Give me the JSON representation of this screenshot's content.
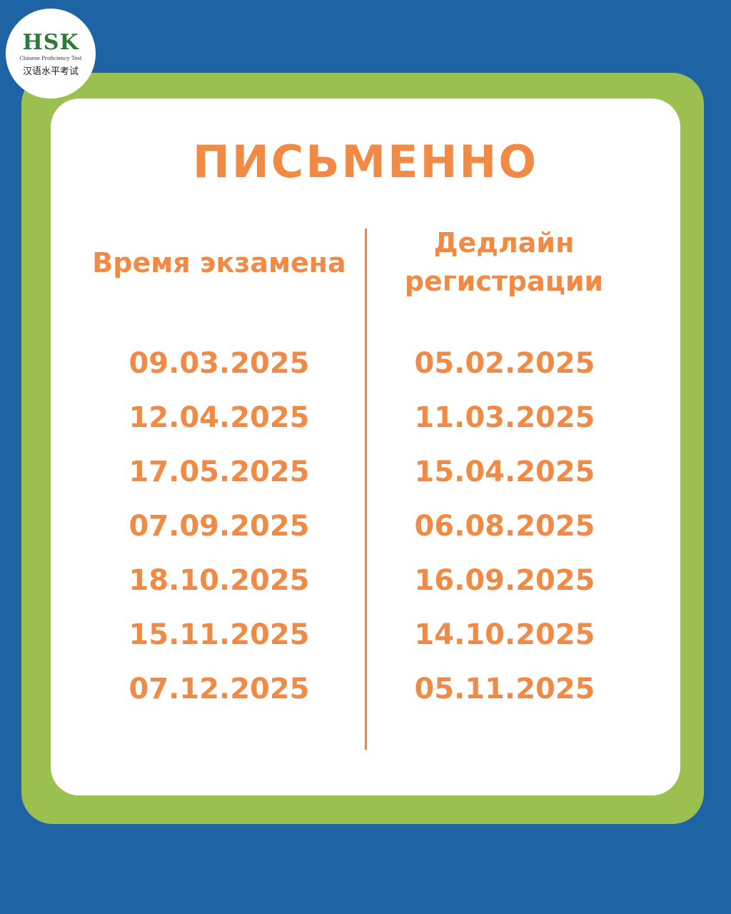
{
  "logo": {
    "main": "HSK",
    "sub": "Chinese Proficiency Test",
    "cn": "汉语水平考试"
  },
  "title": "ПИСЬМЕННО",
  "columns": {
    "exam": {
      "header": "Время экзамена",
      "dates": [
        "09.03.2025",
        "12.04.2025",
        "17.05.2025",
        "07.09.2025",
        "18.10.2025",
        "15.11.2025",
        "07.12.2025"
      ]
    },
    "deadline": {
      "header_line1": "Дедлайн",
      "header_line2": "регистрации",
      "dates": [
        "05.02.2025",
        "11.03.2025",
        "15.04.2025",
        "06.08.2025",
        "16.09.2025",
        "14.10.2025",
        "05.11.2025"
      ]
    }
  },
  "colors": {
    "background": "#1e64a4",
    "frame": "#9cc04f",
    "card": "#ffffff",
    "accent": "#f08a45",
    "logo_green": "#2f7a3a"
  }
}
